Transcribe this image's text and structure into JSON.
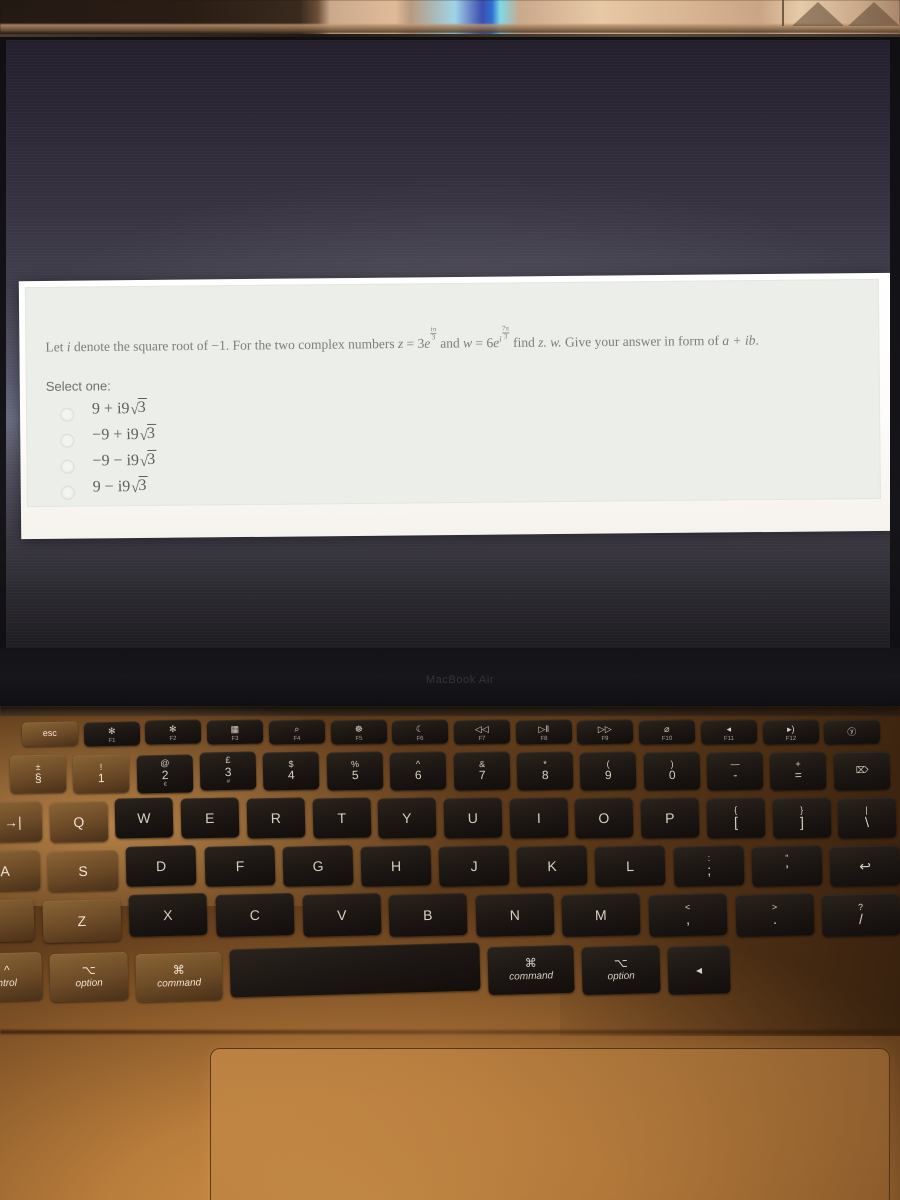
{
  "scene": {
    "device_label": "MacBook Air",
    "description": "photo of a laptop screen showing a multiple-choice math question"
  },
  "quiz": {
    "question": {
      "lead": "Let",
      "i_symbol": "i",
      "part1": "denote the square root of",
      "minus_one": "−1",
      "part2": ". For the two complex numbers",
      "z_symbol": "z",
      "eq1": "=",
      "z_coeff": "3",
      "z_base": "e",
      "z_exp_num": "iπ",
      "z_exp_den": "3",
      "and_word": "and",
      "w_symbol": "w",
      "eq2": "=",
      "w_coeff": "6",
      "w_base": "e",
      "w_exp_i": "i",
      "w_exp_num": "7π",
      "w_exp_den": "3",
      "find_word": "find",
      "find_expr": "z. w.",
      "tail": "Give your answer in form of",
      "form": "a + ib",
      "period": "."
    },
    "select_label": "Select one:",
    "options": [
      {
        "id": "a",
        "prefix": "9 + i9",
        "radical": "3",
        "selected": false
      },
      {
        "id": "b",
        "prefix": "−9 + i9",
        "radical": "3",
        "selected": false
      },
      {
        "id": "c",
        "prefix": "−9 − i9",
        "radical": "3",
        "selected": false
      },
      {
        "id": "d",
        "prefix": "9 − i9",
        "radical": "3",
        "selected": false
      }
    ]
  },
  "keyboard": {
    "function_row": [
      {
        "label": "esc",
        "type": "word",
        "lit": true
      },
      {
        "glyph": "✻",
        "fn": "F1"
      },
      {
        "glyph": "✻",
        "fn": "F2"
      },
      {
        "glyph": "▦",
        "fn": "F3"
      },
      {
        "glyph": "⌕",
        "fn": "F4"
      },
      {
        "glyph": "☸",
        "fn": "F5"
      },
      {
        "glyph": "☾",
        "fn": "F6"
      },
      {
        "glyph": "◁◁",
        "fn": "F7"
      },
      {
        "glyph": "▷‖",
        "fn": "F8"
      },
      {
        "glyph": "▷▷",
        "fn": "F9"
      },
      {
        "glyph": "⌀",
        "fn": "F10"
      },
      {
        "glyph": "◂",
        "fn": "F11"
      },
      {
        "glyph": "▸)",
        "fn": "F12"
      },
      {
        "glyph": "ⓨ",
        "fn": ""
      }
    ],
    "number_row": [
      {
        "top": "±",
        "bot": "§",
        "lit": true
      },
      {
        "top": "!",
        "bot": "1",
        "lit": true
      },
      {
        "top": "@",
        "bot": "2",
        "sub": "€"
      },
      {
        "top": "£",
        "bot": "3",
        "sub": "#"
      },
      {
        "top": "$",
        "bot": "4"
      },
      {
        "top": "%",
        "bot": "5"
      },
      {
        "top": "^",
        "bot": "6"
      },
      {
        "top": "&",
        "bot": "7"
      },
      {
        "top": "*",
        "bot": "8"
      },
      {
        "top": "(",
        "bot": "9"
      },
      {
        "top": ")",
        "bot": "0"
      },
      {
        "top": "—",
        "bot": "-"
      },
      {
        "top": "+",
        "bot": "="
      },
      {
        "top": "⌦",
        "bot": ""
      }
    ],
    "qwerty_row": [
      {
        "bot": "→|",
        "lit": true
      },
      {
        "bot": "Q",
        "lit": true
      },
      {
        "bot": "W"
      },
      {
        "bot": "E"
      },
      {
        "bot": "R"
      },
      {
        "bot": "T"
      },
      {
        "bot": "Y"
      },
      {
        "bot": "U"
      },
      {
        "bot": "I"
      },
      {
        "bot": "O"
      },
      {
        "bot": "P"
      },
      {
        "top": "{",
        "bot": "["
      },
      {
        "top": "}",
        "bot": "]"
      },
      {
        "top": "|",
        "bot": "\\"
      }
    ],
    "home_row": [
      {
        "bot": "A",
        "lit": true
      },
      {
        "bot": "S",
        "lit": true
      },
      {
        "bot": "D"
      },
      {
        "bot": "F"
      },
      {
        "bot": "G"
      },
      {
        "bot": "H"
      },
      {
        "bot": "J"
      },
      {
        "bot": "K"
      },
      {
        "bot": "L"
      },
      {
        "top": ":",
        "bot": ";"
      },
      {
        "top": "\"",
        "bot": "'"
      },
      {
        "top": "",
        "bot": "↩"
      }
    ],
    "zxcv_row": [
      {
        "bot": "~",
        "lit": true
      },
      {
        "bot": "Z",
        "lit": true
      },
      {
        "bot": "X"
      },
      {
        "bot": "C"
      },
      {
        "bot": "V"
      },
      {
        "bot": "B"
      },
      {
        "bot": "N"
      },
      {
        "bot": "M"
      },
      {
        "top": "<",
        "bot": ","
      },
      {
        "top": ">",
        "bot": "."
      },
      {
        "top": "?",
        "bot": "/"
      }
    ],
    "bottom_row": [
      {
        "glyph": "^",
        "word": "ntrol",
        "lit": true
      },
      {
        "glyph": "⌥",
        "word": "option",
        "lit": true
      },
      {
        "glyph": "⌘",
        "word": "command",
        "lit": true
      },
      {
        "glyph": "",
        "word": "",
        "space": true
      },
      {
        "glyph": "⌘",
        "word": "command"
      },
      {
        "glyph": "⌥",
        "word": "option"
      },
      {
        "glyph": "◂",
        "word": ""
      }
    ]
  }
}
